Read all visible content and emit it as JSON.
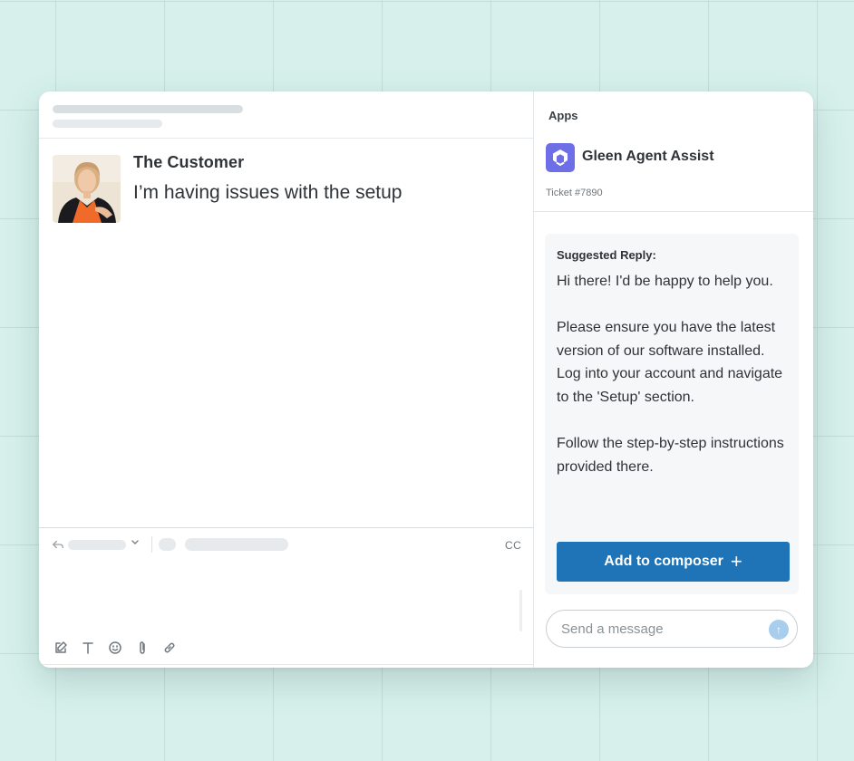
{
  "colors": {
    "background": "#d7f0ec",
    "grid_line": "#b6e3db",
    "primary_button": "#1f73b7",
    "app_logo": "#6e6ee6",
    "send_button": "#a9cdec"
  },
  "conversation": {
    "customer_name": "The Customer",
    "message": "I’m having issues with the setup",
    "avatar_icon": "customer-avatar"
  },
  "composer": {
    "reply_icon": "reply-arrow-icon",
    "cc_label": "CC",
    "toolbar_icons": [
      "compose-icon",
      "text-format-icon",
      "emoji-icon",
      "attachment-icon",
      "link-icon"
    ]
  },
  "apps_panel": {
    "section_label": "Apps",
    "app_name": "Gleen Agent Assist",
    "ticket": "Ticket #7890",
    "suggested_reply": {
      "label": "Suggested Reply:",
      "paragraphs": [
        "Hi there! I'd be happy to help you.",
        "Please ensure you have the latest version of our software installed. Log into your account and navigate to the 'Setup' section.",
        "Follow the step-by-step instructions provided there."
      ]
    },
    "add_button_label": "Add to composer",
    "add_button_icon": "+",
    "message_placeholder": "Send a message",
    "send_icon": "↑"
  }
}
